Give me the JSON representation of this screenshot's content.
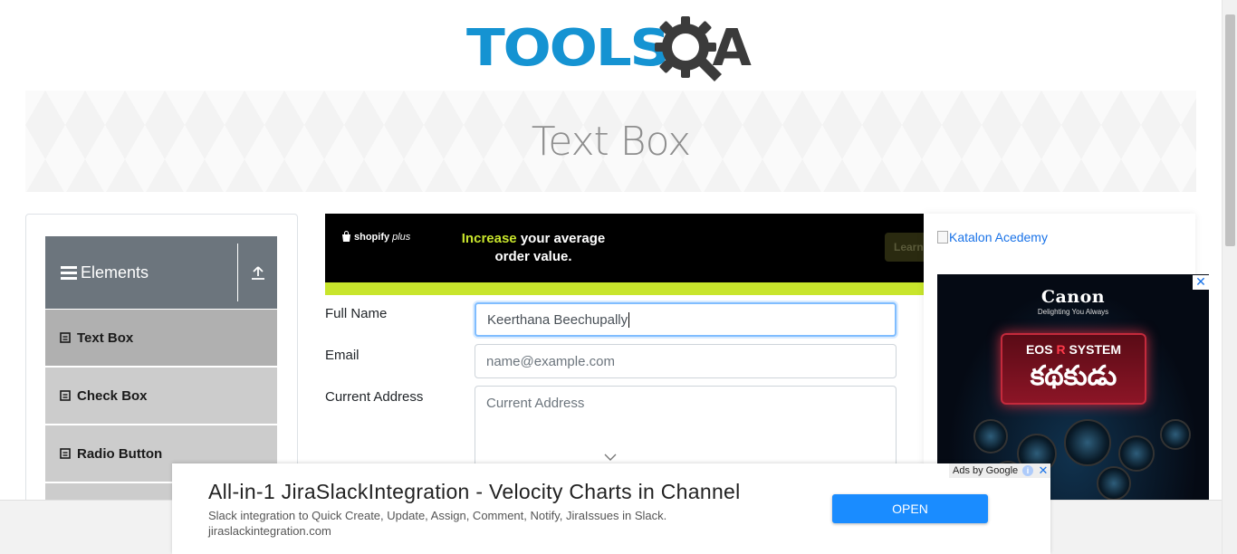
{
  "header": {
    "logo_tools": "TOOLS",
    "logo_qa": "A"
  },
  "banner": {
    "title": "Text Box"
  },
  "sidebar": {
    "group_title": "Elements",
    "items": [
      {
        "label": "Text Box",
        "active": true
      },
      {
        "label": "Check Box",
        "active": false
      },
      {
        "label": "Radio Button",
        "active": false
      }
    ]
  },
  "top_ad": {
    "brand": "shopify",
    "brand_suffix": "plus",
    "headline_highlight": "Increase",
    "headline_rest": " your average",
    "headline_line2": "order value.",
    "cta": "Learn"
  },
  "form": {
    "full_name_label": "Full Name",
    "full_name_value": "Keerthana Beechupally",
    "email_label": "Email",
    "email_placeholder": "name@example.com",
    "address_label": "Current Address",
    "address_placeholder": "Current Address"
  },
  "right_column": {
    "katalon_link": "Katalon Acedemy",
    "canon_ad": {
      "brand": "Canon",
      "tagline": "Delighting You Always",
      "system_prefix": "EOS ",
      "system_r": "R",
      "system_suffix": " SYSTEM",
      "telugu_text": "కథకుడు"
    }
  },
  "bottom_ad": {
    "ads_by": "Ads by Google",
    "title": "All-in-1 JiraSlackIntegration - Velocity Charts in Channel",
    "description": "Slack integration to Quick Create, Update, Assign, Comment, Notify, JiraIssues in Slack.",
    "url": "jiraslackintegration.com",
    "cta": "OPEN"
  },
  "colors": {
    "brand_blue": "#1593d2",
    "sidebar_header": "#6c757d",
    "menu_item": "#cccccc",
    "menu_item_active": "#b0b0b0",
    "input_focus": "#80bdff",
    "ad_cta": "#1a8cff",
    "lime": "#c8e52c"
  }
}
